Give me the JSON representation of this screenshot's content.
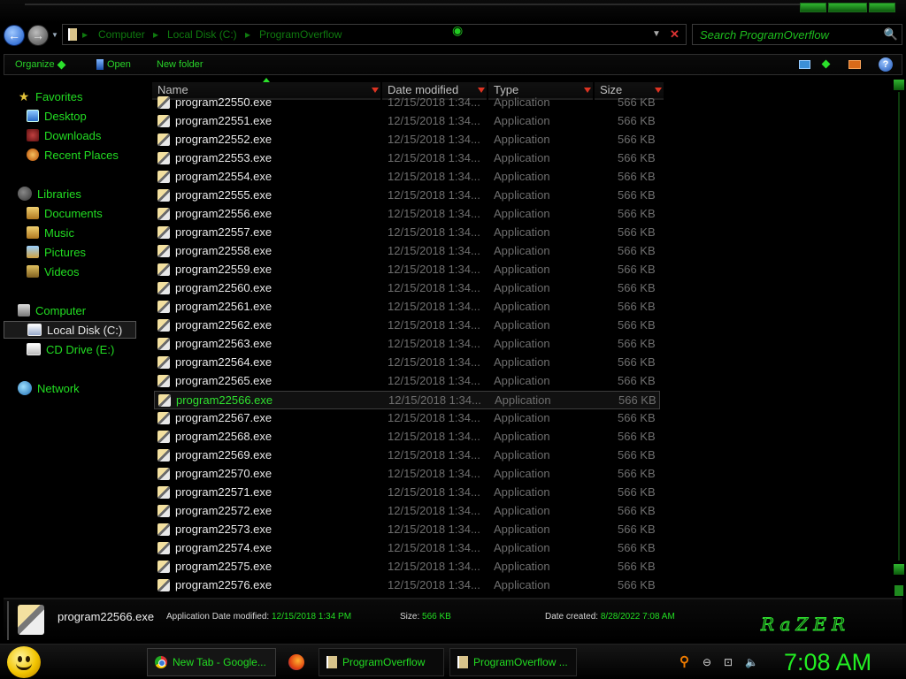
{
  "window": {
    "nav": {
      "back_icon": "back-arrow-icon",
      "forward_icon": "forward-arrow-icon",
      "back_glyph": "←",
      "forward_glyph": "→",
      "history_glyph": "▼"
    },
    "address": {
      "breadcrumbs": [
        "Computer",
        "Local Disk (C:)",
        "ProgramOverflow"
      ],
      "separator": "▸"
    },
    "search": {
      "placeholder": "Search ProgramOverflow",
      "icon_glyph": "🔍"
    },
    "toolbar": {
      "organize": "Organize",
      "open": "Open",
      "new_folder": "New folder",
      "help_glyph": "?"
    },
    "sidebar": {
      "groups": [
        {
          "label": "Favorites",
          "icon": "star-icon",
          "children": [
            {
              "label": "Desktop",
              "icon": "desktop-icon"
            },
            {
              "label": "Downloads",
              "icon": "downloads-icon"
            },
            {
              "label": "Recent Places",
              "icon": "recent-places-icon"
            }
          ]
        },
        {
          "label": "Libraries",
          "icon": "libraries-icon",
          "children": [
            {
              "label": "Documents",
              "icon": "documents-icon"
            },
            {
              "label": "Music",
              "icon": "music-icon"
            },
            {
              "label": "Pictures",
              "icon": "pictures-icon"
            },
            {
              "label": "Videos",
              "icon": "videos-icon"
            }
          ]
        },
        {
          "label": "Computer",
          "icon": "computer-icon",
          "children": [
            {
              "label": "Local Disk (C:)",
              "icon": "local-disk-icon",
              "selected": true
            },
            {
              "label": "CD Drive (E:)",
              "icon": "cd-drive-icon"
            }
          ]
        },
        {
          "label": "Network",
          "icon": "network-icon",
          "children": []
        }
      ],
      "star_glyph": "★"
    },
    "columns": [
      "Name",
      "Date modified",
      "Type",
      "Size"
    ],
    "files": {
      "date": "12/15/2018 1:34...",
      "type": "Application",
      "size": "566 KB",
      "names": [
        "program22550.exe",
        "program22551.exe",
        "program22552.exe",
        "program22553.exe",
        "program22554.exe",
        "program22555.exe",
        "program22556.exe",
        "program22557.exe",
        "program22558.exe",
        "program22559.exe",
        "program22560.exe",
        "program22561.exe",
        "program22562.exe",
        "program22563.exe",
        "program22564.exe",
        "program22565.exe",
        "program22566.exe",
        "program22567.exe",
        "program22568.exe",
        "program22569.exe",
        "program22570.exe",
        "program22571.exe",
        "program22572.exe",
        "program22573.exe",
        "program22574.exe",
        "program22575.exe",
        "program22576.exe"
      ],
      "selected_index": 16
    },
    "details": {
      "name": "program22566.exe",
      "type": "Application",
      "date_modified_label": "Date modified:",
      "date_modified": "12/15/2018 1:34 PM",
      "size_label": "Size:",
      "size": "566 KB",
      "date_created_label": "Date created:",
      "date_created": "8/28/2022 7:08 AM",
      "brand": "RaZER"
    }
  },
  "taskbar": {
    "tasks": [
      {
        "label": "New Tab - Google...",
        "icon": "chrome-icon"
      },
      {
        "label": "",
        "icon": "firefox-icon"
      },
      {
        "label": "ProgramOverflow",
        "icon": "folder-icon"
      },
      {
        "label": "ProgramOverflow ...",
        "icon": "folder-icon"
      }
    ],
    "tray": {
      "search_glyph": "⚲",
      "flag_glyph": "⊖",
      "network_glyph": "⊡",
      "volume_glyph": "🔈"
    },
    "clock": "7:08 AM"
  },
  "colors": {
    "accent": "#22dd22",
    "selection_text": "#2fe02f",
    "background": "#000000",
    "muted_text": "#6e6e6e"
  }
}
